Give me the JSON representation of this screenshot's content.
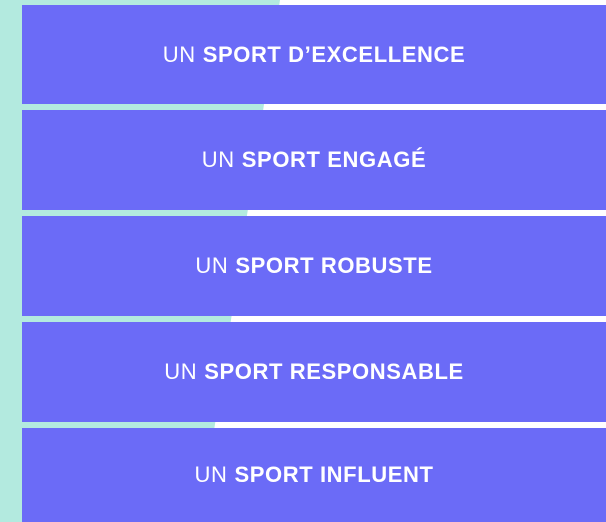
{
  "menu": {
    "items": [
      {
        "prefix": "UN",
        "label": "SPORT D’EXCELLENCE"
      },
      {
        "prefix": "UN",
        "label": "SPORT ENGAGÉ"
      },
      {
        "prefix": "UN",
        "label": "SPORT ROBUSTE"
      },
      {
        "prefix": "UN",
        "label": "SPORT RESPONSABLE"
      },
      {
        "prefix": "UN",
        "label": "SPORT INFLUENT"
      }
    ]
  },
  "colors": {
    "item_background": "#6b6bf7",
    "item_text": "#ffffff",
    "background_accent": "#b3eadf"
  }
}
